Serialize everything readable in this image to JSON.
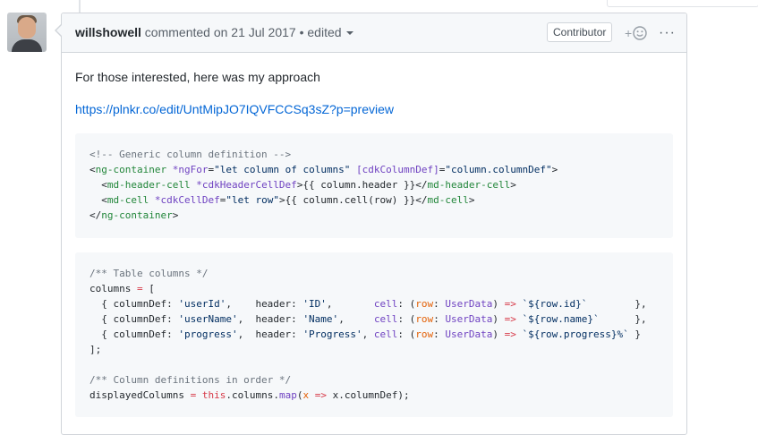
{
  "comment": {
    "author": "willshowell",
    "action": "commented on",
    "date": "21 Jul 2017",
    "separator": "•",
    "edited_label": "edited",
    "role_badge": "Contributor",
    "reaction_plus": "+",
    "more_label": "···",
    "text_intro": "For those interested, here was my approach",
    "link": "https://plnkr.co/edit/UntMipJO7IQVFCCSq3sZ?p=preview"
  },
  "code_blocks": [
    {
      "lines": [
        [
          {
            "t": "c",
            "v": "<!-- Generic column definition -->"
          }
        ],
        [
          {
            "t": "p",
            "v": "<"
          },
          {
            "t": "ent",
            "v": "ng-container"
          },
          {
            "t": "p",
            "v": " "
          },
          {
            "t": "e",
            "v": "*ngFor"
          },
          {
            "t": "p",
            "v": "="
          },
          {
            "t": "s",
            "v": "\"let column of columns\""
          },
          {
            "t": "p",
            "v": " "
          },
          {
            "t": "e",
            "v": "[cdkColumnDef]"
          },
          {
            "t": "p",
            "v": "="
          },
          {
            "t": "s",
            "v": "\"column.columnDef\""
          },
          {
            "t": "p",
            "v": ">"
          }
        ],
        [
          {
            "t": "p",
            "v": "  <"
          },
          {
            "t": "ent",
            "v": "md-header-cell"
          },
          {
            "t": "p",
            "v": " "
          },
          {
            "t": "e",
            "v": "*cdkHeaderCellDef"
          },
          {
            "t": "p",
            "v": ">{{ column.header }}</"
          },
          {
            "t": "ent",
            "v": "md-header-cell"
          },
          {
            "t": "p",
            "v": ">"
          }
        ],
        [
          {
            "t": "p",
            "v": "  <"
          },
          {
            "t": "ent",
            "v": "md-cell"
          },
          {
            "t": "p",
            "v": " "
          },
          {
            "t": "e",
            "v": "*cdkCellDef"
          },
          {
            "t": "p",
            "v": "="
          },
          {
            "t": "s",
            "v": "\"let row\""
          },
          {
            "t": "p",
            "v": ">{{ column.cell(row) }}</"
          },
          {
            "t": "ent",
            "v": "md-cell"
          },
          {
            "t": "p",
            "v": ">"
          }
        ],
        [
          {
            "t": "p",
            "v": "</"
          },
          {
            "t": "ent",
            "v": "ng-container"
          },
          {
            "t": "p",
            "v": ">"
          }
        ]
      ]
    },
    {
      "lines": [
        [
          {
            "t": "c",
            "v": "/** Table columns */"
          }
        ],
        [
          {
            "t": "p",
            "v": "columns "
          },
          {
            "t": "k",
            "v": "="
          },
          {
            "t": "p",
            "v": " ["
          }
        ],
        [
          {
            "t": "p",
            "v": "  { columnDef: "
          },
          {
            "t": "s",
            "v": "'userId'"
          },
          {
            "t": "p",
            "v": ",    header: "
          },
          {
            "t": "s",
            "v": "'ID'"
          },
          {
            "t": "p",
            "v": ",       "
          },
          {
            "t": "e",
            "v": "cell"
          },
          {
            "t": "p",
            "v": ": ("
          },
          {
            "t": "v",
            "v": "row"
          },
          {
            "t": "p",
            "v": ": "
          },
          {
            "t": "e",
            "v": "UserData"
          },
          {
            "t": "p",
            "v": ") "
          },
          {
            "t": "k",
            "v": "=>"
          },
          {
            "t": "p",
            "v": " "
          },
          {
            "t": "s",
            "v": "`${row.id}`"
          },
          {
            "t": "p",
            "v": "        },"
          }
        ],
        [
          {
            "t": "p",
            "v": "  { columnDef: "
          },
          {
            "t": "s",
            "v": "'userName'"
          },
          {
            "t": "p",
            "v": ",  header: "
          },
          {
            "t": "s",
            "v": "'Name'"
          },
          {
            "t": "p",
            "v": ",     "
          },
          {
            "t": "e",
            "v": "cell"
          },
          {
            "t": "p",
            "v": ": ("
          },
          {
            "t": "v",
            "v": "row"
          },
          {
            "t": "p",
            "v": ": "
          },
          {
            "t": "e",
            "v": "UserData"
          },
          {
            "t": "p",
            "v": ") "
          },
          {
            "t": "k",
            "v": "=>"
          },
          {
            "t": "p",
            "v": " "
          },
          {
            "t": "s",
            "v": "`${row.name}`"
          },
          {
            "t": "p",
            "v": "      },"
          }
        ],
        [
          {
            "t": "p",
            "v": "  { columnDef: "
          },
          {
            "t": "s",
            "v": "'progress'"
          },
          {
            "t": "p",
            "v": ",  header: "
          },
          {
            "t": "s",
            "v": "'Progress'"
          },
          {
            "t": "p",
            "v": ", "
          },
          {
            "t": "e",
            "v": "cell"
          },
          {
            "t": "p",
            "v": ": ("
          },
          {
            "t": "v",
            "v": "row"
          },
          {
            "t": "p",
            "v": ": "
          },
          {
            "t": "e",
            "v": "UserData"
          },
          {
            "t": "p",
            "v": ") "
          },
          {
            "t": "k",
            "v": "=>"
          },
          {
            "t": "p",
            "v": " "
          },
          {
            "t": "s",
            "v": "`${row.progress}%`"
          },
          {
            "t": "p",
            "v": " }"
          }
        ],
        [
          {
            "t": "p",
            "v": "];"
          }
        ],
        [],
        [
          {
            "t": "c",
            "v": "/** Column definitions in order */"
          }
        ],
        [
          {
            "t": "p",
            "v": "displayedColumns "
          },
          {
            "t": "k",
            "v": "="
          },
          {
            "t": "p",
            "v": " "
          },
          {
            "t": "k",
            "v": "this"
          },
          {
            "t": "p",
            "v": "."
          },
          {
            "t": "p",
            "v": "columns"
          },
          {
            "t": "p",
            "v": "."
          },
          {
            "t": "e",
            "v": "map"
          },
          {
            "t": "p",
            "v": "("
          },
          {
            "t": "v",
            "v": "x"
          },
          {
            "t": "p",
            "v": " "
          },
          {
            "t": "k",
            "v": "=>"
          },
          {
            "t": "p",
            "v": " "
          },
          {
            "t": "p",
            "v": "x.columnDef);"
          }
        ]
      ]
    }
  ]
}
